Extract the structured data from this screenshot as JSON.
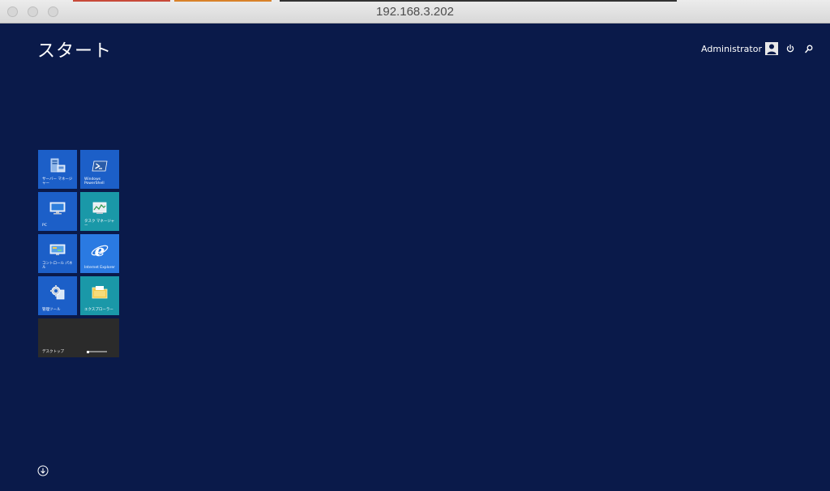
{
  "window": {
    "title": "192.168.3.202"
  },
  "start": {
    "title": "スタート",
    "user": "Administrator"
  },
  "tiles": [
    {
      "id": "server-manager",
      "label": "サーバー マネージャー",
      "color": "#1c5fc8"
    },
    {
      "id": "powershell",
      "label": "Windows PowerShell",
      "color": "#1c5fc8"
    },
    {
      "id": "pc",
      "label": "PC",
      "color": "#1c5fc8"
    },
    {
      "id": "task-manager",
      "label": "タスク マネージャー",
      "color": "#1a98a8"
    },
    {
      "id": "control-panel",
      "label": "コントロール パネル",
      "color": "#1c5fc8"
    },
    {
      "id": "internet-explorer",
      "label": "Internet Explorer",
      "color": "#2a7ae2"
    },
    {
      "id": "admin-tools",
      "label": "管理ツール",
      "color": "#1c5fc8"
    },
    {
      "id": "explorer",
      "label": "エクスプローラー",
      "color": "#1a98a8"
    },
    {
      "id": "desktop",
      "label": "デスクトップ",
      "color": "#2b2b2b"
    }
  ],
  "colors": {
    "background": "#0a1a4a",
    "tile_blue": "#1c5fc8",
    "tile_teal": "#1a98a8"
  },
  "icons": {
    "power": "power-icon",
    "search": "search-icon",
    "apps_arrow": "down-arrow-icon"
  }
}
